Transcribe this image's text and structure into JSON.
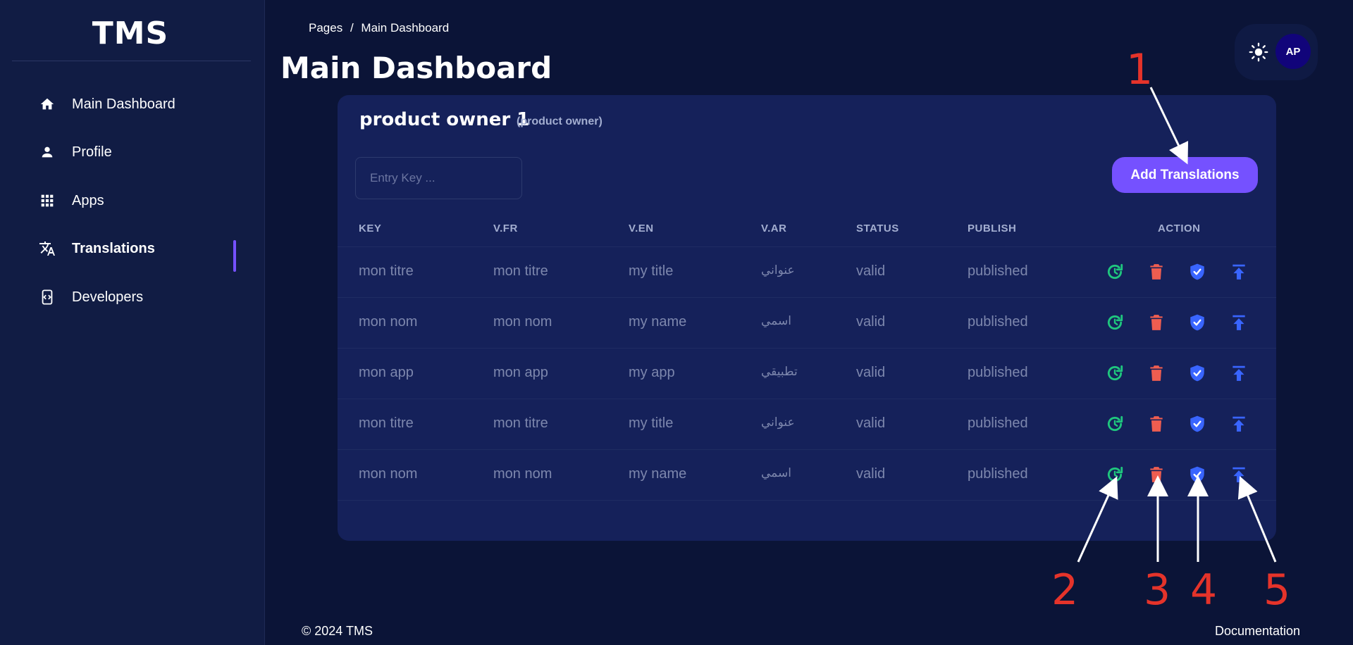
{
  "app": {
    "logo": "TMS"
  },
  "sidebar": {
    "items": [
      {
        "label": "Main Dashboard",
        "icon": "home-icon"
      },
      {
        "label": "Profile",
        "icon": "person-icon"
      },
      {
        "label": "Apps",
        "icon": "grid-icon"
      },
      {
        "label": "Translations",
        "icon": "translate-icon",
        "active": true
      },
      {
        "label": "Developers",
        "icon": "code-icon"
      }
    ]
  },
  "header": {
    "breadcrumb": {
      "root": "Pages",
      "separator": "/",
      "current": "Main Dashboard"
    },
    "title": "Main Dashboard",
    "avatar": "AP",
    "theme_icon": "sun-icon"
  },
  "card": {
    "title": "product owner 1",
    "subtitle": "(product owner)",
    "search_placeholder": "Entry Key ...",
    "add_button": "Add Translations"
  },
  "table": {
    "headers": [
      "KEY",
      "V.FR",
      "V.EN",
      "V.AR",
      "STATUS",
      "PUBLISH",
      "ACTION"
    ],
    "rows": [
      {
        "key": "mon titre",
        "fr": "mon titre",
        "en": "my title",
        "ar": "عنواني",
        "status": "valid",
        "publish": "published"
      },
      {
        "key": "mon nom",
        "fr": "mon nom",
        "en": "my name",
        "ar": "اسمي",
        "status": "valid",
        "publish": "published"
      },
      {
        "key": "mon app",
        "fr": "mon app",
        "en": "my app",
        "ar": "تطبيقي",
        "status": "valid",
        "publish": "published"
      },
      {
        "key": "mon titre",
        "fr": "mon titre",
        "en": "my title",
        "ar": "عنواني",
        "status": "valid",
        "publish": "published"
      },
      {
        "key": "mon nom",
        "fr": "mon nom",
        "en": "my name",
        "ar": "اسمي",
        "status": "valid",
        "publish": "published"
      }
    ],
    "actions": [
      "refresh-icon",
      "trash-icon",
      "shield-check-icon",
      "publish-icon"
    ]
  },
  "annotations": [
    "1",
    "2",
    "3",
    "4",
    "5"
  ],
  "footer": {
    "copyright": "© 2024 TMS",
    "link": "Documentation"
  },
  "colors": {
    "background": "#0b1437",
    "sidebar": "#111c44",
    "card": "#15215a",
    "accent": "#7551ff",
    "refresh": "#1fc77e",
    "trash": "#ee5d50",
    "shield": "#3965ff",
    "publish": "#3965ff",
    "annotation": "#e5332a"
  }
}
